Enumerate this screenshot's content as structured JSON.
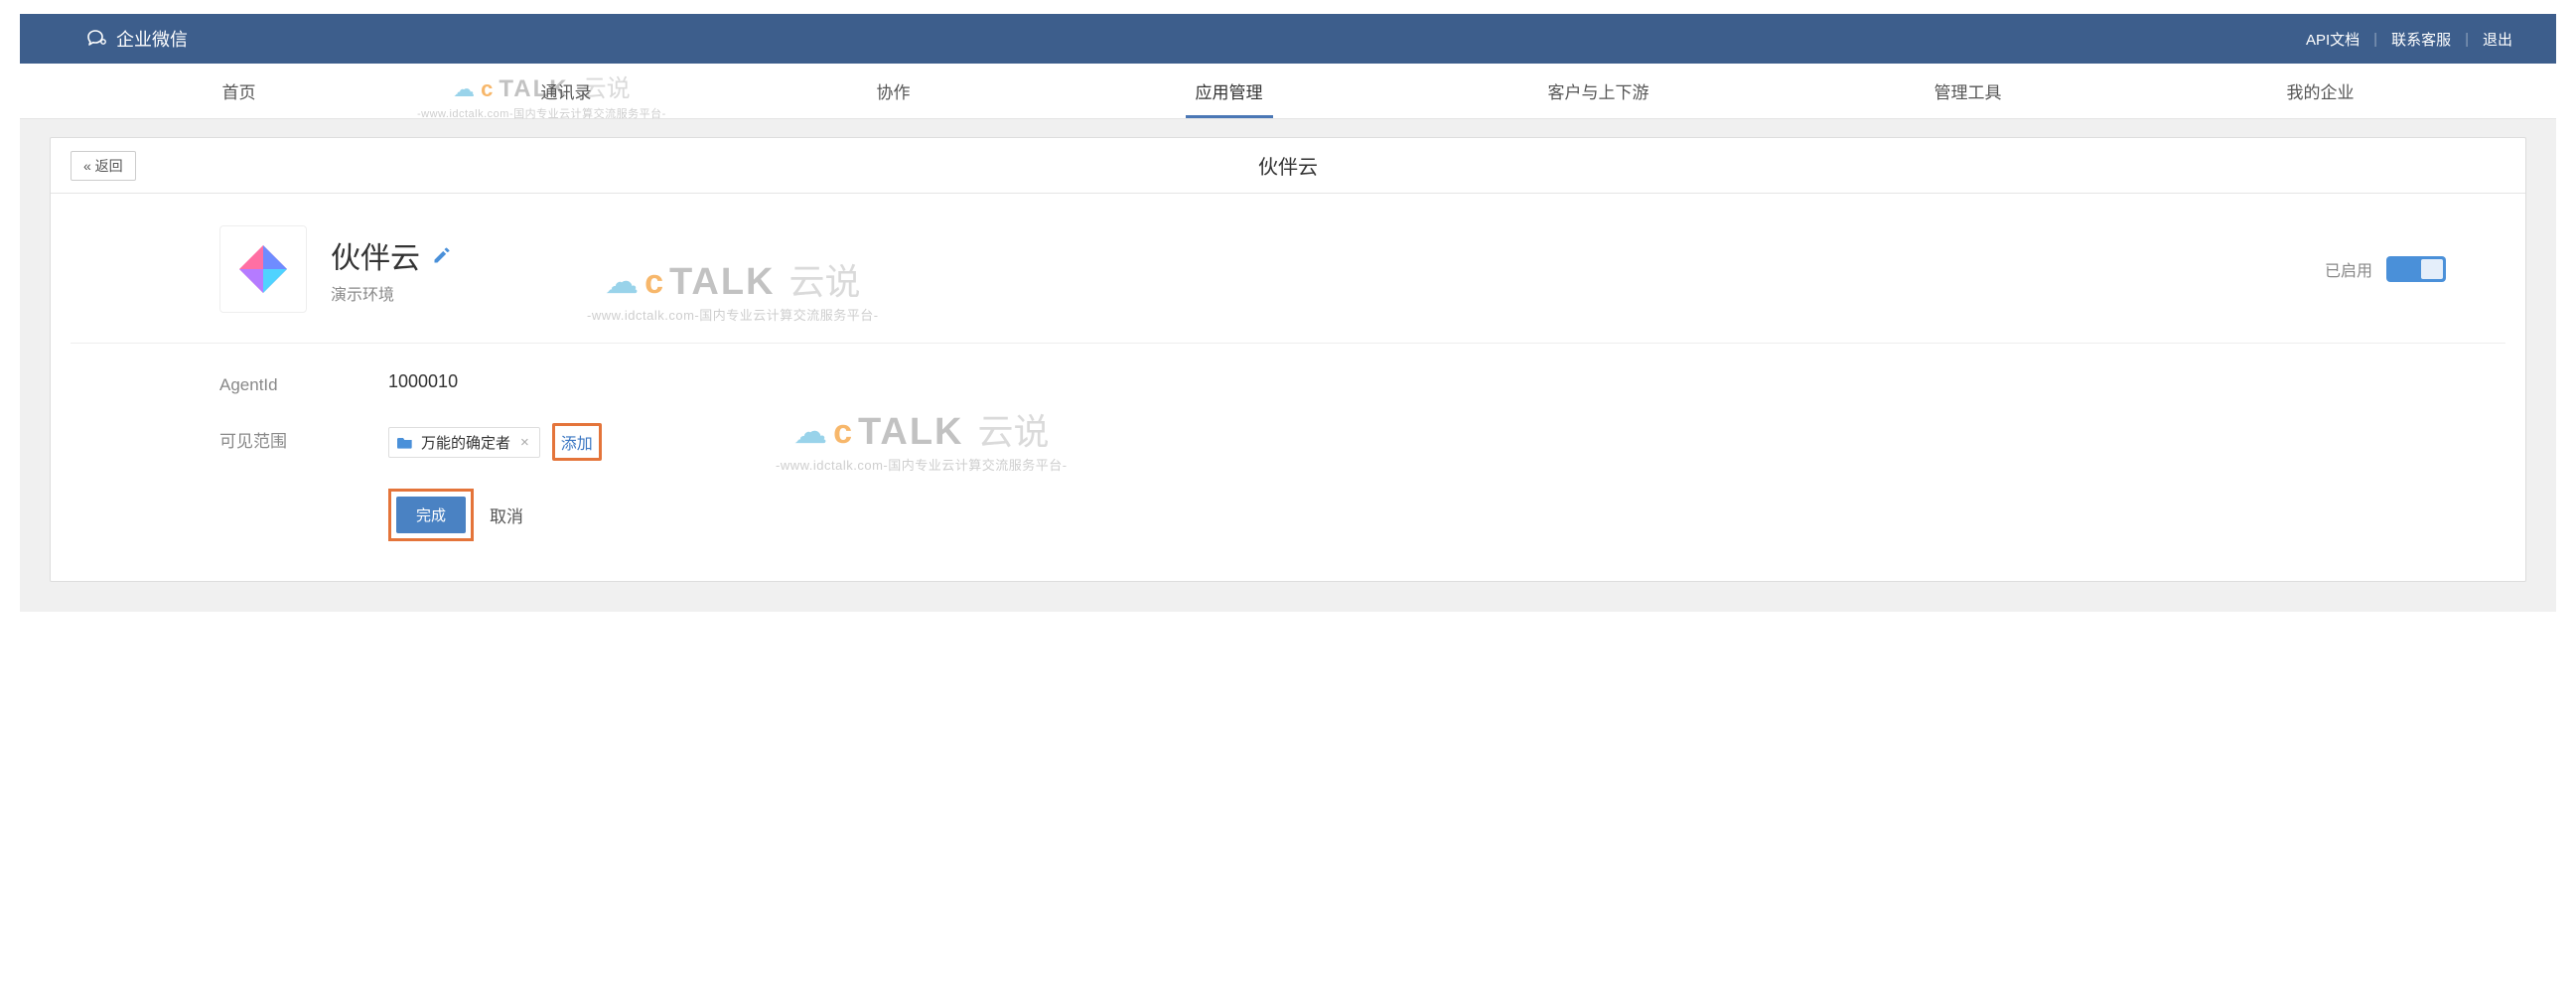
{
  "brand": {
    "name": "企业微信"
  },
  "top_links": {
    "api": "API文档",
    "contact": "联系客服",
    "logout": "退出"
  },
  "nav": {
    "items": [
      {
        "label": "首页"
      },
      {
        "label": "通讯录"
      },
      {
        "label": "协作"
      },
      {
        "label": "应用管理",
        "active": true
      },
      {
        "label": "客户与上下游"
      },
      {
        "label": "管理工具"
      },
      {
        "label": "我的企业"
      }
    ]
  },
  "panel": {
    "back_label": "« 返回",
    "title": "伙伴云"
  },
  "app": {
    "name": "伙伴云",
    "subtitle": "演示环境",
    "status_text": "已启用"
  },
  "fields": {
    "agent_id": {
      "label": "AgentId",
      "value": "1000010"
    },
    "scope": {
      "label": "可见范围",
      "tag_text": "万能的确定者",
      "add_label": "添加"
    }
  },
  "actions": {
    "done": "完成",
    "cancel": "取消"
  },
  "watermark": {
    "talk": "TALK",
    "cn": "云说",
    "sub": "-www.idctalk.com-国内专业云计算交流服务平台-"
  }
}
